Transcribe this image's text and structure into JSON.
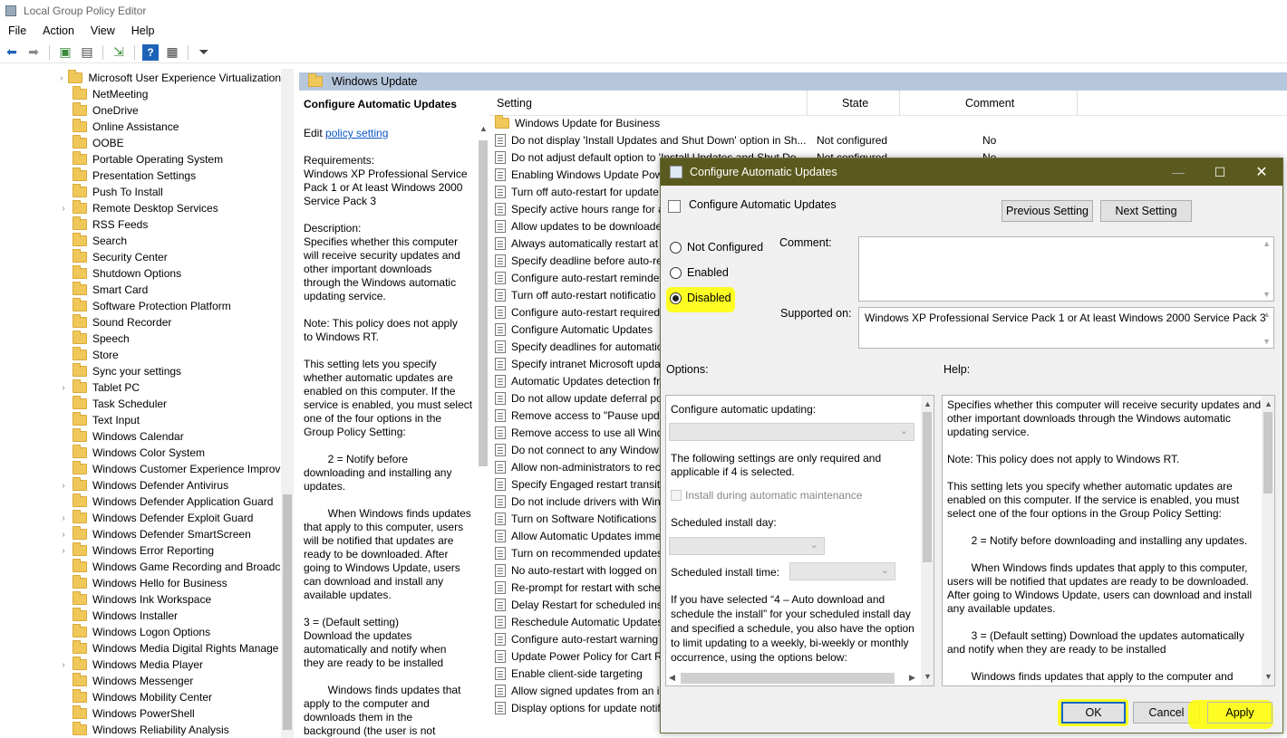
{
  "window": {
    "title": "Local Group Policy Editor"
  },
  "menu": [
    "File",
    "Action",
    "View",
    "Help"
  ],
  "tree": {
    "items": [
      {
        "label": "Microsoft User Experience Virtualization",
        "exp": true
      },
      {
        "label": "NetMeeting",
        "exp": false
      },
      {
        "label": "OneDrive",
        "exp": false
      },
      {
        "label": "Online Assistance",
        "exp": false
      },
      {
        "label": "OOBE",
        "exp": false
      },
      {
        "label": "Portable Operating System",
        "exp": false
      },
      {
        "label": "Presentation Settings",
        "exp": false
      },
      {
        "label": "Push To Install",
        "exp": false
      },
      {
        "label": "Remote Desktop Services",
        "exp": true
      },
      {
        "label": "RSS Feeds",
        "exp": false
      },
      {
        "label": "Search",
        "exp": false
      },
      {
        "label": "Security Center",
        "exp": false
      },
      {
        "label": "Shutdown Options",
        "exp": false
      },
      {
        "label": "Smart Card",
        "exp": false
      },
      {
        "label": "Software Protection Platform",
        "exp": false
      },
      {
        "label": "Sound Recorder",
        "exp": false
      },
      {
        "label": "Speech",
        "exp": false
      },
      {
        "label": "Store",
        "exp": false
      },
      {
        "label": "Sync your settings",
        "exp": false
      },
      {
        "label": "Tablet PC",
        "exp": true
      },
      {
        "label": "Task Scheduler",
        "exp": false
      },
      {
        "label": "Text Input",
        "exp": false
      },
      {
        "label": "Windows Calendar",
        "exp": false
      },
      {
        "label": "Windows Color System",
        "exp": false
      },
      {
        "label": "Windows Customer Experience Improv",
        "exp": false
      },
      {
        "label": "Windows Defender Antivirus",
        "exp": true
      },
      {
        "label": "Windows Defender Application Guard",
        "exp": false
      },
      {
        "label": "Windows Defender Exploit Guard",
        "exp": true
      },
      {
        "label": "Windows Defender SmartScreen",
        "exp": true
      },
      {
        "label": "Windows Error Reporting",
        "exp": true
      },
      {
        "label": "Windows Game Recording and Broadc",
        "exp": false
      },
      {
        "label": "Windows Hello for Business",
        "exp": false
      },
      {
        "label": "Windows Ink Workspace",
        "exp": false
      },
      {
        "label": "Windows Installer",
        "exp": false
      },
      {
        "label": "Windows Logon Options",
        "exp": false
      },
      {
        "label": "Windows Media Digital Rights Manage",
        "exp": false
      },
      {
        "label": "Windows Media Player",
        "exp": true
      },
      {
        "label": "Windows Messenger",
        "exp": false
      },
      {
        "label": "Windows Mobility Center",
        "exp": false
      },
      {
        "label": "Windows PowerShell",
        "exp": false
      },
      {
        "label": "Windows Reliability Analysis",
        "exp": false
      }
    ]
  },
  "folder_header": "Windows Update",
  "desc": {
    "title": "Configure Automatic Updates",
    "edit_prefix": "Edit",
    "edit_link": "policy setting",
    "lines": [
      "Requirements:",
      "Windows XP Professional Service",
      "Pack 1 or At least Windows 2000",
      "Service Pack 3",
      "",
      "Description:",
      "Specifies whether this computer",
      "will receive security updates and",
      "other important downloads",
      "through the Windows automatic",
      "updating service.",
      "",
      "Note: This policy does not apply",
      "to Windows RT.",
      "",
      "This setting lets you specify",
      "whether automatic updates are",
      "enabled on this computer. If the",
      "service is enabled, you must select",
      "one of the four options in the",
      "Group Policy Setting:",
      "",
      "        2 = Notify before",
      "downloading and installing any",
      "updates.",
      "",
      "        When Windows finds updates",
      "that apply to this computer, users",
      "will be notified that updates are",
      "ready to be downloaded. After",
      "going to Windows Update, users",
      "can download and install any",
      "available updates.",
      "",
      "3 = (Default setting)",
      "Download the updates",
      "automatically and notify when",
      "they are ready to be installed",
      "",
      "        Windows finds updates that",
      "apply to the computer and",
      "downloads them in the",
      "background (the user is not"
    ]
  },
  "list": {
    "headers": {
      "setting": "Setting",
      "state": "State",
      "comment": "Comment"
    },
    "rows": [
      {
        "name": "Windows Update for Business",
        "state": "",
        "comment": "",
        "folder": true
      },
      {
        "name": "Do not display 'Install Updates and Shut Down' option in Sh...",
        "state": "Not configured",
        "comment": "No"
      },
      {
        "name": "Do not adjust default option to 'Install Updates and Shut Do...",
        "state": "Not configured",
        "comment": "No"
      },
      {
        "name": "Enabling Windows Update Pow",
        "state": "",
        "comment": ""
      },
      {
        "name": "Turn off auto-restart for update",
        "state": "",
        "comment": ""
      },
      {
        "name": "Specify active hours range for a",
        "state": "",
        "comment": ""
      },
      {
        "name": "Allow updates to be downloade",
        "state": "",
        "comment": ""
      },
      {
        "name": "Always automatically restart at",
        "state": "",
        "comment": ""
      },
      {
        "name": "Specify deadline before auto-re",
        "state": "",
        "comment": ""
      },
      {
        "name": "Configure auto-restart reminde",
        "state": "",
        "comment": ""
      },
      {
        "name": "Turn off auto-restart notificatio",
        "state": "",
        "comment": ""
      },
      {
        "name": "Configure auto-restart required",
        "state": "",
        "comment": ""
      },
      {
        "name": "Configure Automatic Updates",
        "state": "",
        "comment": ""
      },
      {
        "name": "Specify deadlines for automatic",
        "state": "",
        "comment": ""
      },
      {
        "name": "Specify intranet Microsoft upda",
        "state": "",
        "comment": ""
      },
      {
        "name": "Automatic Updates detection fr",
        "state": "",
        "comment": ""
      },
      {
        "name": "Do not allow update deferral po",
        "state": "",
        "comment": ""
      },
      {
        "name": "Remove access to \"Pause updat",
        "state": "",
        "comment": ""
      },
      {
        "name": "Remove access to use all Windo",
        "state": "",
        "comment": ""
      },
      {
        "name": "Do not connect to any Window",
        "state": "",
        "comment": ""
      },
      {
        "name": "Allow non-administrators to rec",
        "state": "",
        "comment": ""
      },
      {
        "name": "Specify Engaged restart transitio",
        "state": "",
        "comment": ""
      },
      {
        "name": "Do not include drivers with Win",
        "state": "",
        "comment": ""
      },
      {
        "name": "Turn on Software Notifications",
        "state": "",
        "comment": ""
      },
      {
        "name": "Allow Automatic Updates imme",
        "state": "",
        "comment": ""
      },
      {
        "name": "Turn on recommended updates",
        "state": "",
        "comment": ""
      },
      {
        "name": "No auto-restart with logged on",
        "state": "",
        "comment": ""
      },
      {
        "name": "Re-prompt for restart with sche",
        "state": "",
        "comment": ""
      },
      {
        "name": "Delay Restart for scheduled inst",
        "state": "",
        "comment": ""
      },
      {
        "name": "Reschedule Automatic Updates",
        "state": "",
        "comment": ""
      },
      {
        "name": "Configure auto-restart warning",
        "state": "",
        "comment": ""
      },
      {
        "name": "Update Power Policy for Cart Re",
        "state": "",
        "comment": ""
      },
      {
        "name": "Enable client-side targeting",
        "state": "",
        "comment": ""
      },
      {
        "name": "Allow signed updates from an i",
        "state": "",
        "comment": ""
      },
      {
        "name": "Display options for update notif",
        "state": "",
        "comment": ""
      }
    ]
  },
  "dialog": {
    "title": "Configure Automatic Updates",
    "heading": "Configure Automatic Updates",
    "prev": "Previous Setting",
    "next": "Next Setting",
    "radio_not": "Not Configured",
    "radio_en": "Enabled",
    "radio_dis": "Disabled",
    "selected": "Disabled",
    "comment_label": "Comment:",
    "supported_label": "Supported on:",
    "supported_value": "Windows XP Professional Service Pack 1 or At least Windows 2000 Service Pack 3",
    "options_label": "Options:",
    "help_label": "Help:",
    "opt_configure": "Configure automatic updating:",
    "opt_note": "The following settings are only required and applicable if 4 is selected.",
    "opt_install_maint": "Install during automatic maintenance",
    "opt_day": "Scheduled install day:",
    "opt_time": "Scheduled install time:",
    "opt_para": "If you have selected “4 – Auto download and schedule the install” for your scheduled install day and specified a schedule, you also have the option to limit updating to a weekly, bi-weekly or monthly occurrence, using the options below:",
    "help_lines": [
      "Specifies whether this computer will receive security updates and",
      "other important downloads through the Windows automatic",
      "updating service.",
      "",
      "Note: This policy does not apply to Windows RT.",
      "",
      "This setting lets you specify whether automatic updates are",
      "enabled on this computer. If the service is enabled, you must",
      "select one of the four options in the Group Policy Setting:",
      "",
      "        2 = Notify before downloading and installing any updates.",
      "",
      "        When Windows finds updates that apply to this computer,",
      "users will be notified that updates are ready to be downloaded.",
      "After going to Windows Update, users can download and install",
      "any available updates.",
      "",
      "        3 = (Default setting) Download the updates automatically",
      "and notify when they are ready to be installed",
      "",
      "        Windows finds updates that apply to the computer and"
    ],
    "ok": "OK",
    "cancel": "Cancel",
    "apply": "Apply"
  },
  "colors": {
    "dialog_title_bg": "#5a5a1e",
    "folder_header_bg": "#b6c7dc",
    "highlight": "#ffff00",
    "link": "#0b57c7"
  }
}
